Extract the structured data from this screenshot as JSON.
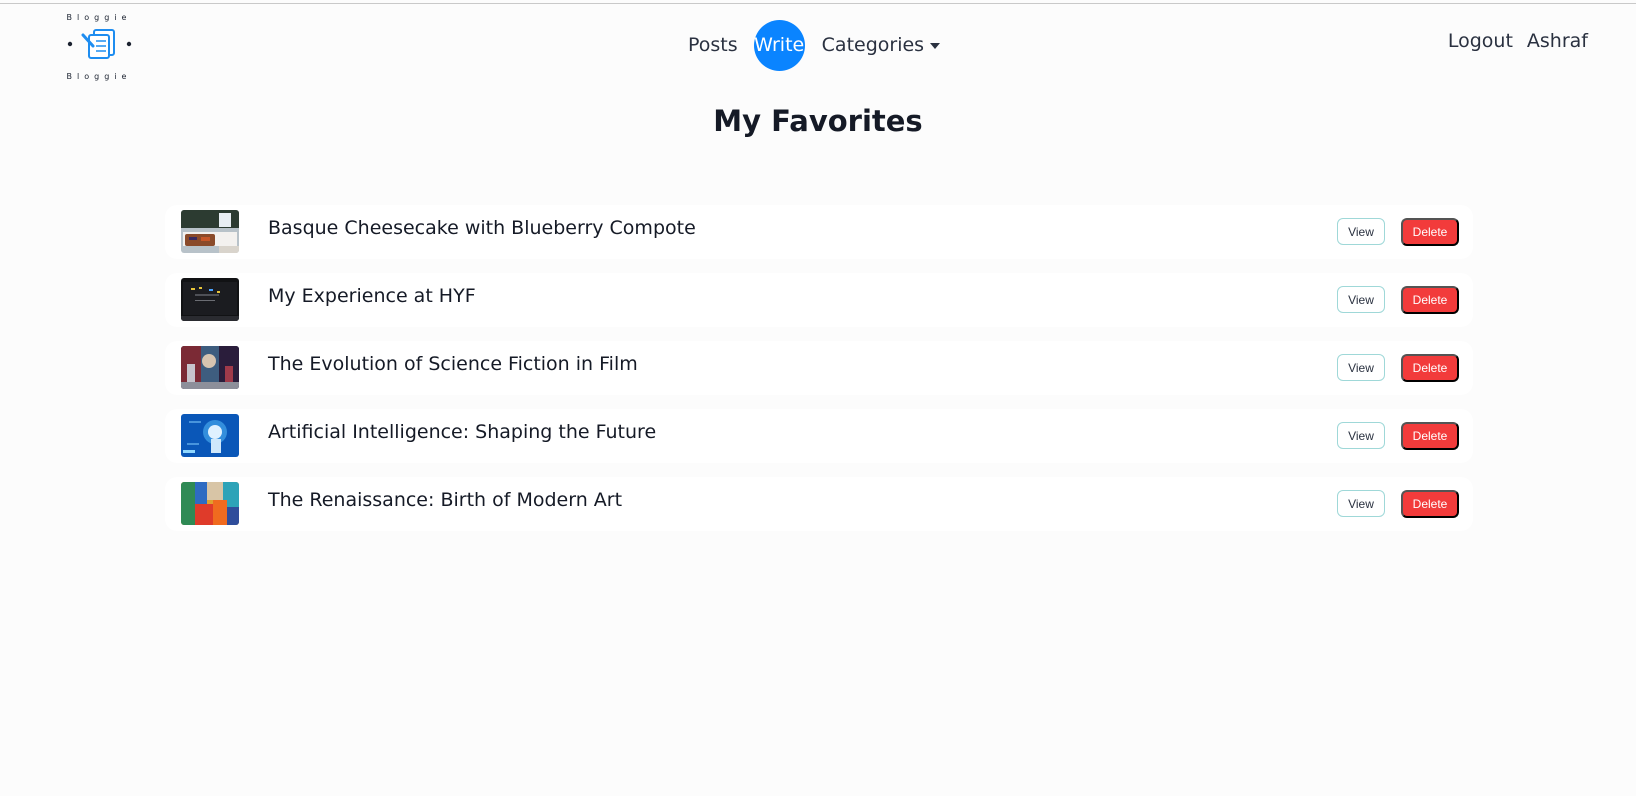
{
  "logo": {
    "text": "Bloggie"
  },
  "nav": {
    "posts": "Posts",
    "write": "Write",
    "categories": "Categories",
    "logout": "Logout",
    "user": "Ashraf"
  },
  "page": {
    "title": "My Favorites"
  },
  "favorites": [
    {
      "title": "Basque Cheesecake with Blueberry Compote",
      "view": "View",
      "delete": "Delete"
    },
    {
      "title": "My Experience at HYF",
      "view": "View",
      "delete": "Delete"
    },
    {
      "title": "The Evolution of Science Fiction in Film",
      "view": "View",
      "delete": "Delete"
    },
    {
      "title": "Artificial Intelligence: Shaping the Future",
      "view": "View",
      "delete": "Delete"
    },
    {
      "title": "The Renaissance: Birth of Modern Art",
      "view": "View",
      "delete": "Delete"
    }
  ],
  "colors": {
    "accent": "#0a84ff",
    "danger": "#f23b3b",
    "view_border": "#9fd8d8"
  }
}
